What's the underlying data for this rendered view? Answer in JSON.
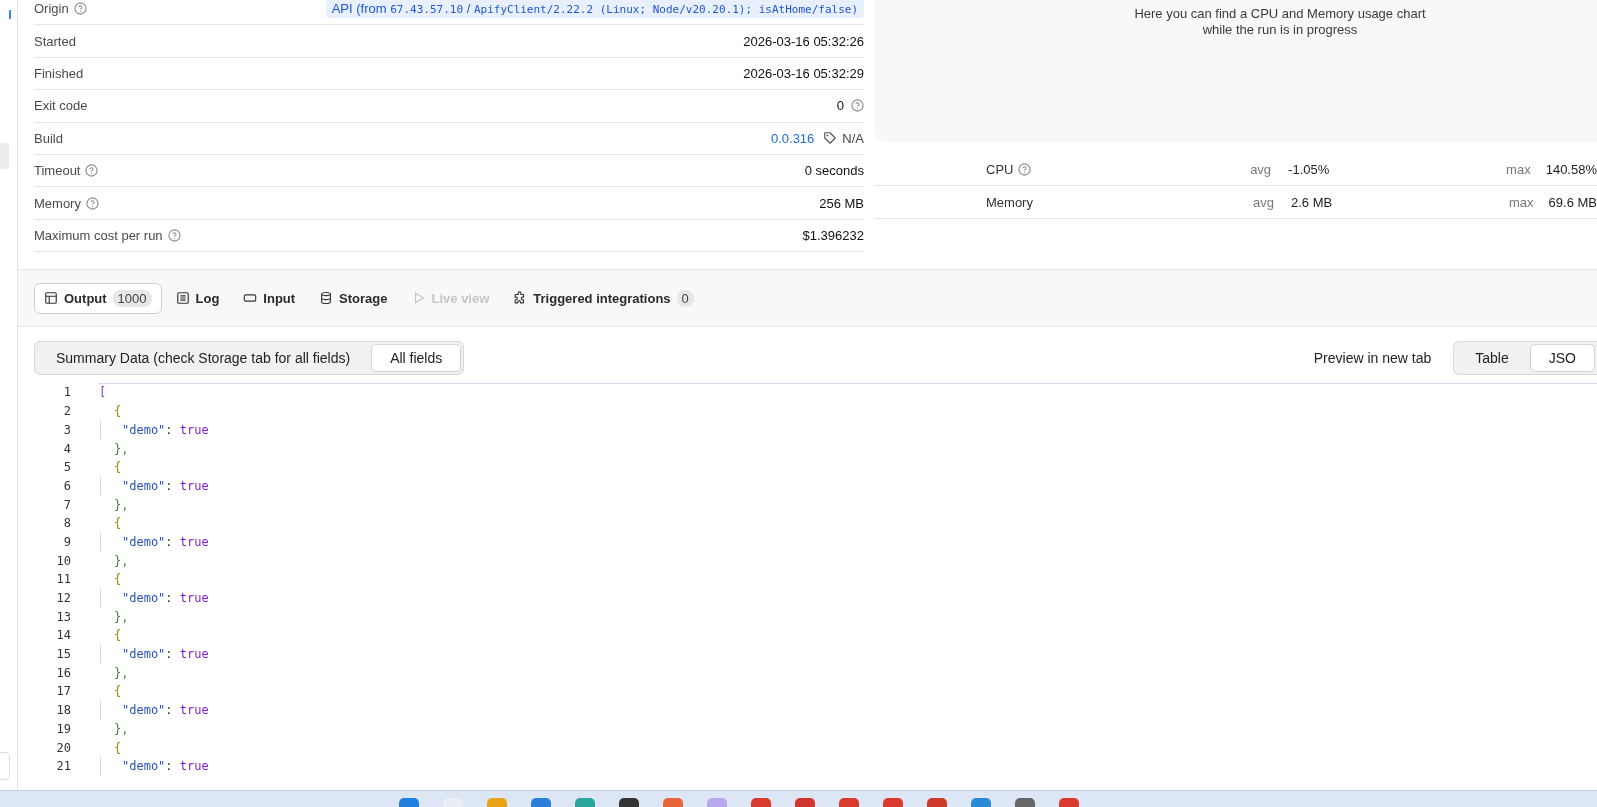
{
  "details": [
    {
      "label": "Origin",
      "help": true,
      "kind": "origin",
      "value_prefix": "API (from ",
      "value_mono": "67.43.57.10",
      "value_sep": " / ",
      "value_client": "ApifyClient/2.22.2 (Linux; Node/v20.20.1); isAtHome/false)"
    },
    {
      "label": "Started",
      "help": false,
      "kind": "text",
      "value": "2026-03-16 05:32:26"
    },
    {
      "label": "Finished",
      "help": false,
      "kind": "text",
      "value": "2026-03-16 05:32:29"
    },
    {
      "label": "Exit code",
      "help": false,
      "kind": "text_help",
      "value": "0"
    },
    {
      "label": "Build",
      "help": false,
      "kind": "build",
      "value": "0.0.316",
      "tag": "N/A"
    },
    {
      "label": "Timeout",
      "help": true,
      "kind": "text",
      "value": "0 seconds"
    },
    {
      "label": "Memory",
      "help": true,
      "kind": "text",
      "value": "256 MB"
    },
    {
      "label": "Maximum cost per run",
      "help": true,
      "kind": "text",
      "value": "$1.396232"
    }
  ],
  "chart_panel": {
    "message_line_1": "Here you can find a CPU and Memory usage chart",
    "message_line_2": "while the run is in progress"
  },
  "usage": [
    {
      "label": "CPU",
      "help": true,
      "avg_label": "avg",
      "avg": "-1.05%",
      "max_label": "max",
      "max": "140.58%"
    },
    {
      "label": "Memory",
      "help": false,
      "avg_label": "avg",
      "avg": "2.6 MB",
      "max_label": "max",
      "max": "69.6 MB"
    }
  ],
  "tabs": [
    {
      "label": "Output",
      "kind": "table",
      "badge": "1000",
      "selected": true,
      "disabled": false
    },
    {
      "label": "Log",
      "kind": "list",
      "selected": false,
      "disabled": false
    },
    {
      "label": "Input",
      "kind": "input",
      "selected": false,
      "disabled": false
    },
    {
      "label": "Storage",
      "kind": "database",
      "selected": false,
      "disabled": false
    },
    {
      "label": "Live view",
      "kind": "play",
      "selected": false,
      "disabled": true
    },
    {
      "label": "Triggered integrations",
      "kind": "puzzle",
      "badge": "0",
      "selected": false,
      "disabled": false
    }
  ],
  "view_toggle": [
    {
      "label": "Summary Data (check Storage tab for all fields)",
      "selected": false
    },
    {
      "label": "All fields",
      "selected": true
    }
  ],
  "preview_link": "Preview in new tab",
  "format_toggle": [
    {
      "label": "Table",
      "selected": false
    },
    {
      "label": "JSO",
      "selected": true
    }
  ],
  "code_lines": [
    {
      "number": "1",
      "kind": "array_open",
      "text": "["
    },
    {
      "number": "2",
      "kind": "object_open",
      "text": "{"
    },
    {
      "number": "3",
      "kind": "pair",
      "key": "\"demo\"",
      "sep": ": ",
      "value": "true"
    },
    {
      "number": "4",
      "kind": "object_close",
      "text": "},"
    },
    {
      "number": "5",
      "kind": "object_open",
      "text": "{"
    },
    {
      "number": "6",
      "kind": "pair",
      "key": "\"demo\"",
      "sep": ": ",
      "value": "true"
    },
    {
      "number": "7",
      "kind": "object_close",
      "text": "},"
    },
    {
      "number": "8",
      "kind": "object_open",
      "text": "{"
    },
    {
      "number": "9",
      "kind": "pair",
      "key": "\"demo\"",
      "sep": ": ",
      "value": "true"
    },
    {
      "number": "10",
      "kind": "object_close",
      "text": "},"
    },
    {
      "number": "11",
      "kind": "object_open",
      "text": "{"
    },
    {
      "number": "12",
      "kind": "pair",
      "key": "\"demo\"",
      "sep": ": ",
      "value": "true"
    },
    {
      "number": "13",
      "kind": "object_close",
      "text": "},"
    },
    {
      "number": "14",
      "kind": "object_open",
      "text": "{"
    },
    {
      "number": "15",
      "kind": "pair",
      "key": "\"demo\"",
      "sep": ": ",
      "value": "true"
    },
    {
      "number": "16",
      "kind": "object_close",
      "text": "},"
    },
    {
      "number": "17",
      "kind": "object_open",
      "text": "{"
    },
    {
      "number": "18",
      "kind": "pair",
      "key": "\"demo\"",
      "sep": ": ",
      "value": "true"
    },
    {
      "number": "19",
      "kind": "object_close",
      "text": "},"
    },
    {
      "number": "20",
      "kind": "object_open",
      "text": "{"
    },
    {
      "number": "21",
      "kind": "pair",
      "key": "\"demo\"",
      "sep": ": ",
      "value": "true"
    }
  ]
}
